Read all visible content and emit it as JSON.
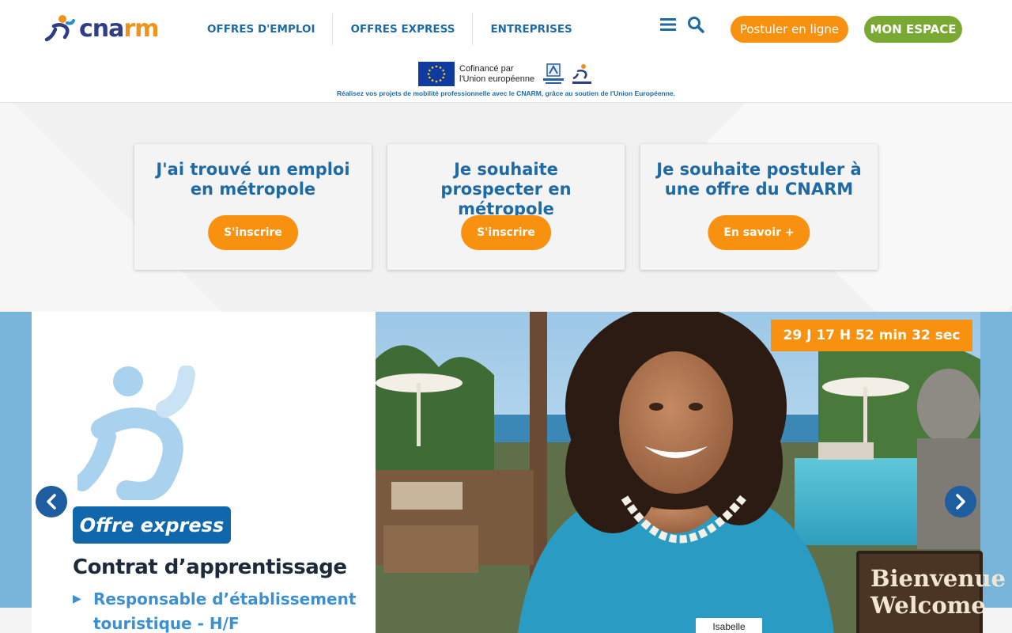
{
  "header": {
    "logo_text": {
      "part1": "cna",
      "part2": "rm"
    },
    "nav": [
      {
        "label": "OFFRES D'EMPLOI"
      },
      {
        "label": "OFFRES EXPRESS"
      },
      {
        "label": "ENTREPRISES"
      }
    ],
    "apply_button": "Postuler en ligne",
    "space_button": "MON ESPACE",
    "eu_banner": {
      "cofinance_line1": "Cofinancé par",
      "cofinance_line2": "l'Union européenne",
      "caption": "Réalisez vos projets de mobilité professionnelle avec le CNARM, grâce au soutien de l'Union Européenne."
    }
  },
  "cards": [
    {
      "title": "J'ai trouvé un emploi en métropole",
      "button": "S'inscrire"
    },
    {
      "title": "Je souhaite prospecter en métropole",
      "button": "S'inscrire"
    },
    {
      "title": "Je souhaite postuler à une offre du CNARM",
      "button": "En savoir +"
    }
  ],
  "slider": {
    "badge": "Offre express",
    "contract": "Contrat d’apprentissage",
    "job_title": "Responsable d’établissement touristique - H/F",
    "countdown": "29 J 17 H 52 min 32 sec",
    "name_tag": "Isabelle",
    "sign_line1": "Bienvenue",
    "sign_line2": "Welcome"
  },
  "colors": {
    "brand_blue": "#1e6aa6",
    "orange": "#f7910f",
    "green": "#79a932",
    "dark_blue": "#1d5da0"
  },
  "icons": {
    "menu": "hamburger-icon",
    "search": "search-icon",
    "prev": "chevron-left-icon",
    "next": "chevron-right-icon"
  }
}
